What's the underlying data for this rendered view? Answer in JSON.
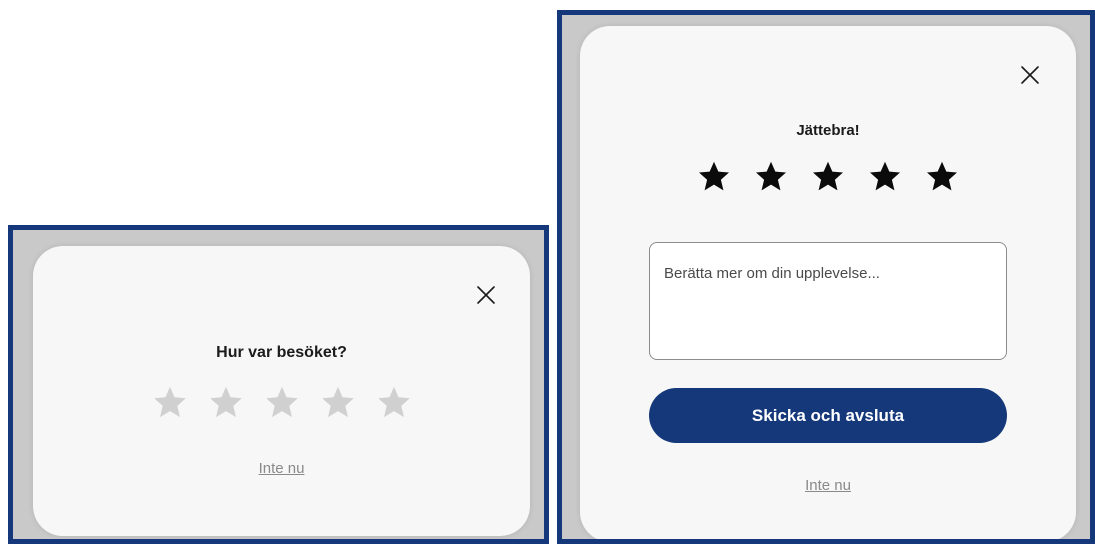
{
  "colors": {
    "frame_border": "#143879",
    "primary_button": "#143879",
    "star_empty": "#d0d0d0",
    "star_filled": "#0b0b0b",
    "link": "#8a8a8a"
  },
  "rating_initial": {
    "title": "Hur var besöket?",
    "close_icon": "close-icon",
    "stars_filled": 0,
    "stars_total": 5,
    "dismiss_label": "Inte nu"
  },
  "rating_feedback": {
    "title": "Jättebra!",
    "close_icon": "close-icon",
    "stars_filled": 5,
    "stars_total": 5,
    "feedback_placeholder": "Berätta mer om din upplevelse...",
    "feedback_value": "",
    "submit_label": "Skicka och avsluta",
    "dismiss_label": "Inte nu"
  }
}
